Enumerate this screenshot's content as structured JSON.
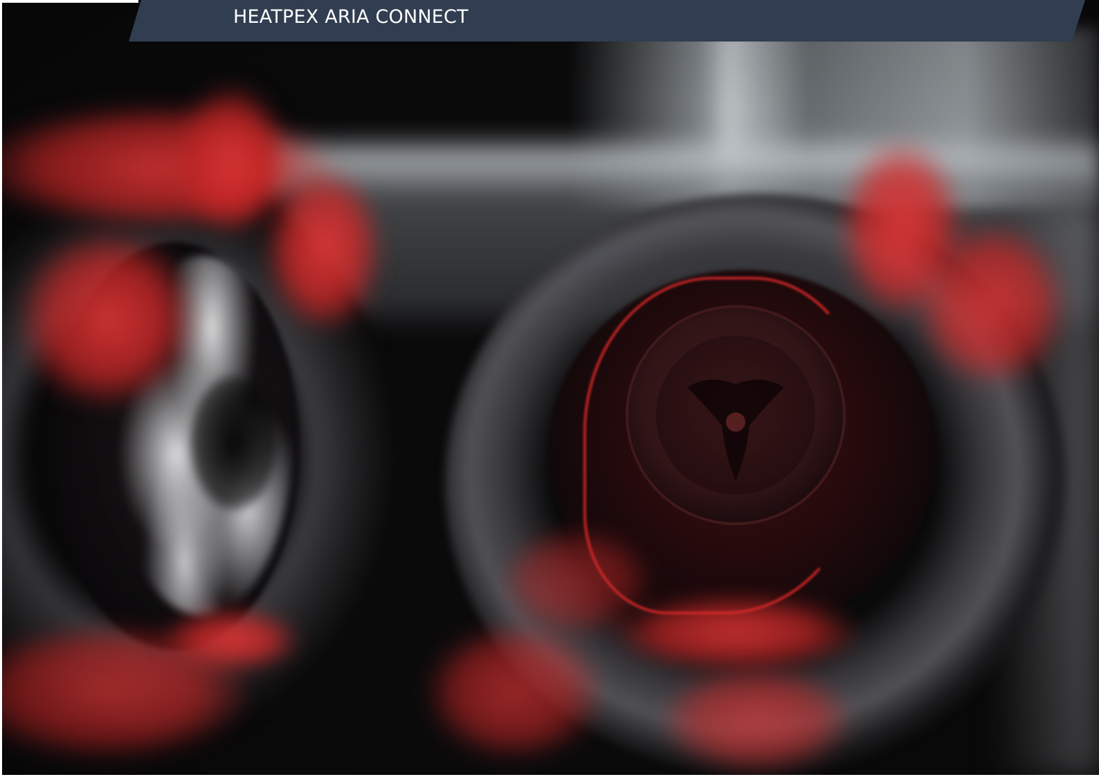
{
  "header": {
    "title": "HEATPEX ARIA CONNECT",
    "banner_color": "#313d50",
    "text_color": "#ffffff"
  },
  "hero_image": {
    "accent_color": "#e03a3a"
  }
}
